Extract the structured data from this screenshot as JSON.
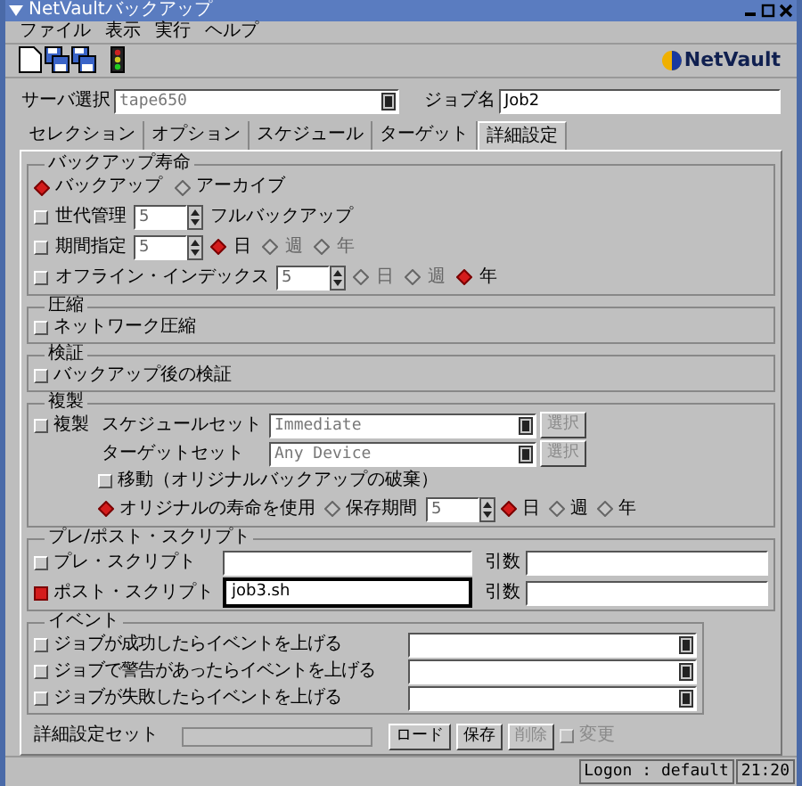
{
  "window": {
    "title": "NetVaultバックアップ"
  },
  "menu": [
    "ファイル",
    "表示",
    "実行",
    "ヘルプ"
  ],
  "toolbar": {
    "logo": "NetVault"
  },
  "server": {
    "label": "サーバ選択",
    "value": "tape650"
  },
  "job_name": {
    "label": "ジョブ名",
    "value": "Job2"
  },
  "tabs": [
    {
      "label": "セレクション",
      "selected": false
    },
    {
      "label": "オプション",
      "selected": false
    },
    {
      "label": "スケジュール",
      "selected": false
    },
    {
      "label": "ターゲット",
      "selected": false
    },
    {
      "label": "詳細設定",
      "selected": true
    }
  ],
  "backup_life": {
    "title": "バックアップ寿命",
    "type_options": [
      {
        "label": "バックアップ",
        "selected": true
      },
      {
        "label": "アーカイブ",
        "selected": false
      }
    ],
    "rows": [
      {
        "kind": "suffix",
        "label": "世代管理",
        "checked": false,
        "value": "5",
        "suffix": "フルバックアップ"
      },
      {
        "kind": "units",
        "label": "期間指定",
        "checked": false,
        "value": "5",
        "units": [
          {
            "label": "日",
            "selected": true
          },
          {
            "label": "週",
            "selected": false
          },
          {
            "label": "年",
            "selected": false
          }
        ]
      },
      {
        "kind": "units",
        "label": "オフライン・インデックス",
        "checked": false,
        "value": "5",
        "units": [
          {
            "label": "日",
            "selected": false
          },
          {
            "label": "週",
            "selected": false
          },
          {
            "label": "年",
            "selected": true
          }
        ]
      }
    ]
  },
  "compression": {
    "title": "圧縮",
    "option": {
      "label": "ネットワーク圧縮",
      "checked": false
    }
  },
  "verify": {
    "title": "検証",
    "option": {
      "label": "バックアップ後の検証",
      "checked": false
    }
  },
  "duplication": {
    "title": "複製",
    "option": {
      "label": "複製",
      "checked": false
    },
    "sets": [
      {
        "label": "スケジュールセット",
        "value": "Immediate",
        "button": "選択"
      },
      {
        "label": "ターゲットセット",
        "value": "Any Device",
        "button": "選択"
      }
    ],
    "move": {
      "label": "移動（オリジナルバックアップの破棄）",
      "checked": false
    },
    "retention": [
      {
        "label": "オリジナルの寿命を使用",
        "selected": true
      },
      {
        "label": "保存期間",
        "selected": false
      }
    ],
    "period": "5",
    "units": [
      {
        "label": "日",
        "selected": true
      },
      {
        "label": "週",
        "selected": false
      },
      {
        "label": "年",
        "selected": false
      }
    ]
  },
  "scripts": {
    "title": "プレ/ポスト・スクリプト",
    "rows": [
      {
        "label": "プレ・スクリプト",
        "checked": false,
        "args_label": "引数"
      },
      {
        "label": "ポスト・スクリプト",
        "checked": true,
        "value": "job3.sh",
        "args_label": "引数"
      }
    ]
  },
  "events": {
    "title": "イベント",
    "rows": [
      {
        "label": "ジョブが成功したらイベントを上げる",
        "checked": false
      },
      {
        "label": "ジョブで警告があったらイベントを上げる",
        "checked": false
      },
      {
        "label": "ジョブが失敗したらイベントを上げる",
        "checked": false
      }
    ]
  },
  "settings_set": {
    "label": "詳細設定セット",
    "buttons": [
      {
        "label": "ロード",
        "disabled": false
      },
      {
        "label": "保存",
        "disabled": false
      },
      {
        "label": "削除",
        "disabled": true
      }
    ],
    "change": {
      "label": "変更",
      "checked": false,
      "disabled": true
    }
  },
  "status_bar": {
    "logon": "Logon : default",
    "time": "21:20"
  }
}
